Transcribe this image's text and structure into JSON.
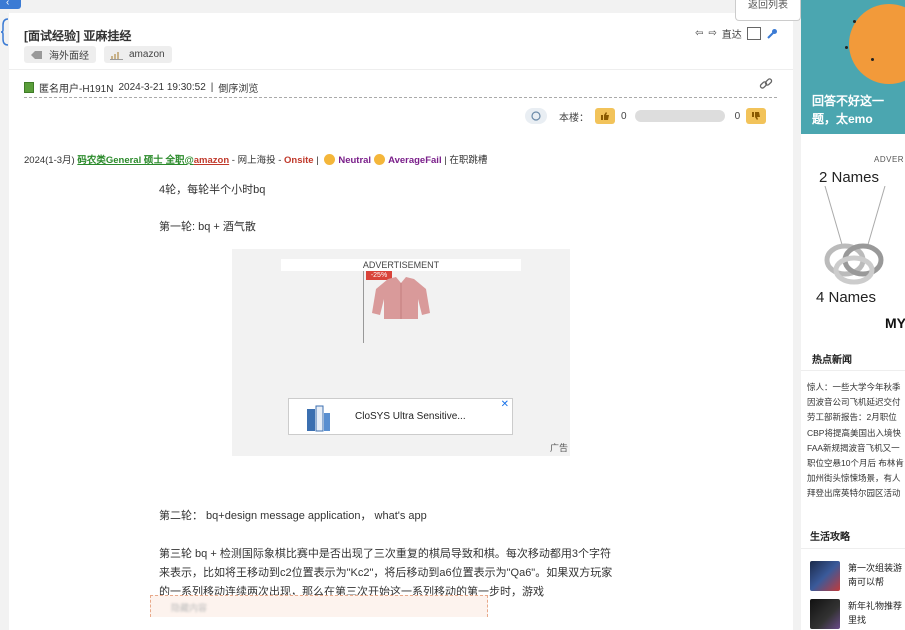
{
  "top": {
    "back_label": "返回列表"
  },
  "post": {
    "title": "[面试经验] 亚麻挂经",
    "tools": {
      "goto_label": "直达"
    },
    "tags": [
      "海外面经",
      "amazon"
    ],
    "author": "匿名用户-H191N",
    "datetime": "2024-3-21 19:30:52",
    "reverse_view": "倒序浏览",
    "vote": {
      "label": "本楼：",
      "up_count": "0",
      "down_count": "0"
    },
    "meta": {
      "period": "2024(1-3月)",
      "school": "码农类General 硕士 全职@",
      "company": "amazon",
      "source": " - 网上海投 - ",
      "onsite": "Onsite",
      "sep": " | ",
      "neutral": "Neutral",
      "result": "AverageFail",
      "status": " | 在职跳槽"
    },
    "paragraphs": {
      "p1": "4轮，每轮半个小时bq",
      "p2": "第一轮: bq + 酒气散",
      "p3": "第二轮： bq+design message application， what's app",
      "p4_l1": "第三轮 bq + 检测国际象棋比赛中是否出现了三次重复的棋局导致和棋。每次移动都用3个字符",
      "p4_l2": "来表示，比如将王移动到c2位置表示为\"Kc2\"，将后移动到a6位置表示为\"Qa6\"。如果双方玩家",
      "p4_l3": "的一系列移动连续两次出现，那么在第三次开始这一系列移动的第一步时，游戏"
    },
    "ad": {
      "label": "ADVERTISEMENT",
      "discount": "-25%",
      "product_name": "CloSYS Ultra Sensitive...",
      "close": "✕",
      "ad_tag": "广告"
    },
    "hidden_text": "隐藏内容"
  },
  "sidebar": {
    "banner_text": "回答不好这一题，太emo",
    "advert": "ADVER",
    "names1": "2 Names",
    "names2": "4 Names",
    "brand": "MY",
    "hot_title": "热点新闻",
    "news": [
      "惊人：一些大学今年秋季",
      "因波音公司飞机延迟交付",
      "劳工部新报告：2月职位",
      "CBP将提高美国出入境快",
      "FAA新规揭波音飞机又一",
      "职位空悬10个月后 布林肯",
      "加州街头惊悚场景，有人",
      "拜登出席英特尔园区活动"
    ],
    "life_title": "生活攻略",
    "life": [
      {
        "l1": "第一次组装游",
        "l2": "南可以帮"
      },
      {
        "l1": "新年礼物推荐",
        "l2": "里找"
      }
    ]
  },
  "colors": {
    "accent": "#3b7bd4",
    "green": "#2a8a2a",
    "red": "#c0392b",
    "purple": "#7a1f8a"
  }
}
